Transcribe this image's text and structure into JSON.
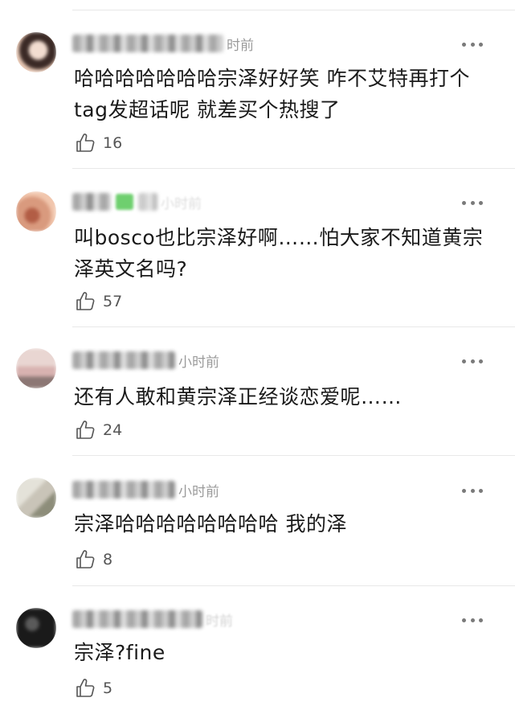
{
  "comments": [
    {
      "time": "时前",
      "text": "哈哈哈哈哈哈哈宗泽好好笑 咋不艾特再打个tag发超话呢 就差买个热搜了",
      "likes": "16",
      "avatar_colors": [
        "#e9c9b5",
        "#3b2a26",
        "#f2ddd0"
      ]
    },
    {
      "time": "小时前",
      "text": "叫bosco也比宗泽好啊……怕大家不知道黄宗泽英文名吗?",
      "likes": "57",
      "avatar_colors": [
        "#d99a7e",
        "#b25d45",
        "#f1c6ad"
      ]
    },
    {
      "time": "小时前",
      "text": "还有人敢和黄宗泽正经谈恋爱呢……",
      "likes": "24",
      "avatar_colors": [
        "#d8b2b0",
        "#8c7774",
        "#e9d6d2"
      ]
    },
    {
      "time": "小时前",
      "text": "宗泽哈哈哈哈哈哈哈哈 我的泽",
      "likes": "8",
      "avatar_colors": [
        "#c9c4b8",
        "#8d8d7a",
        "#e4e2d9"
      ]
    },
    {
      "time": "时前",
      "text": "宗泽?fine",
      "likes": "5",
      "avatar_colors": [
        "#1a1a1a",
        "#3a3a3a",
        "#5a5a5a"
      ]
    }
  ]
}
